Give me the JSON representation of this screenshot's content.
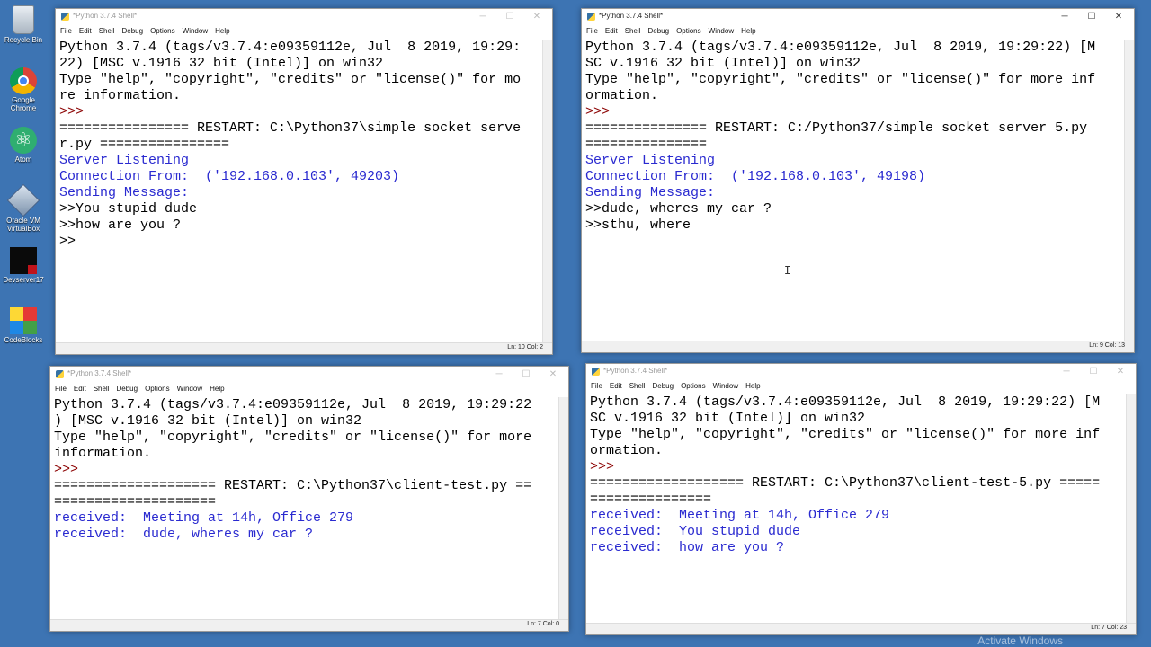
{
  "desktop": {
    "icons": [
      {
        "label": "Recycle Bin",
        "icon": "recycle-bin-icon"
      },
      {
        "label": "Google Chrome",
        "icon": "chrome-icon"
      },
      {
        "label": "Atom",
        "icon": "atom-icon"
      },
      {
        "label": "Oracle VM VirtualBox",
        "icon": "virtualbox-icon"
      },
      {
        "label": "Devserver17",
        "icon": "devserver-icon"
      },
      {
        "label": "CodeBlocks",
        "icon": "codeblocks-icon"
      }
    ],
    "watermark": "Activate Windows"
  },
  "menu_items": [
    "File",
    "Edit",
    "Shell",
    "Debug",
    "Options",
    "Window",
    "Help"
  ],
  "window_controls": {
    "minimize": "─",
    "maximize": "☐",
    "close": "✕"
  },
  "windows": [
    {
      "title": "*Python 3.7.4 Shell*",
      "status": "Ln: 10   Col: 2",
      "lines": [
        {
          "t": "Python 3.7.4 (tags/v3.7.4:e09359112e, Jul  8 2019, 19:29:",
          "c": "input"
        },
        {
          "t": "22) [MSC v.1916 32 bit (Intel)] on win32",
          "c": "input"
        },
        {
          "t": "Type \"help\", \"copyright\", \"credits\" or \"license()\" for mo",
          "c": "input"
        },
        {
          "t": "re information.",
          "c": "input"
        },
        {
          "t": ">>> ",
          "c": "prompt"
        },
        {
          "t": "================ RESTART: C:\\Python37\\simple socket serve",
          "c": "input"
        },
        {
          "t": "r.py ================",
          "c": "input"
        },
        {
          "t": "Server Listening",
          "c": "out"
        },
        {
          "t": "Connection From:  ('192.168.0.103', 49203)",
          "c": "out"
        },
        {
          "t": "Sending Message:",
          "c": "out"
        },
        {
          "t": ">>You stupid dude",
          "c": "input"
        },
        {
          "t": ">>how are you ?",
          "c": "input"
        },
        {
          "t": ">> ",
          "c": "input"
        }
      ]
    },
    {
      "title": "*Python 3.7.4 Shell*",
      "status": "Ln: 9   Col: 13",
      "lines": [
        {
          "t": "Python 3.7.4 (tags/v3.7.4:e09359112e, Jul  8 2019, 19:29:22) [M",
          "c": "input"
        },
        {
          "t": "SC v.1916 32 bit (Intel)] on win32",
          "c": "input"
        },
        {
          "t": "Type \"help\", \"copyright\", \"credits\" or \"license()\" for more inf",
          "c": "input"
        },
        {
          "t": "ormation.",
          "c": "input"
        },
        {
          "t": ">>> ",
          "c": "prompt"
        },
        {
          "t": "=============== RESTART: C:/Python37/simple socket server 5.py",
          "c": "input"
        },
        {
          "t": "===============",
          "c": "input"
        },
        {
          "t": "Server Listening",
          "c": "out"
        },
        {
          "t": "Connection From:  ('192.168.0.103', 49198)",
          "c": "out"
        },
        {
          "t": "Sending Message:",
          "c": "out"
        },
        {
          "t": ">>dude, wheres my car ?",
          "c": "input"
        },
        {
          "t": ">>sthu, where",
          "c": "input"
        }
      ]
    },
    {
      "title": "*Python 3.7.4 Shell*",
      "status": "Ln: 7   Col: 0",
      "lines": [
        {
          "t": "Python 3.7.4 (tags/v3.7.4:e09359112e, Jul  8 2019, 19:29:22",
          "c": "input"
        },
        {
          "t": ") [MSC v.1916 32 bit (Intel)] on win32",
          "c": "input"
        },
        {
          "t": "Type \"help\", \"copyright\", \"credits\" or \"license()\" for more",
          "c": "input"
        },
        {
          "t": "information.",
          "c": "input"
        },
        {
          "t": ">>> ",
          "c": "prompt"
        },
        {
          "t": "==================== RESTART: C:\\Python37\\client-test.py ==",
          "c": "input"
        },
        {
          "t": "====================",
          "c": "input"
        },
        {
          "t": "received:  Meeting at 14h, Office 279",
          "c": "out"
        },
        {
          "t": "received:  dude, wheres my car ?",
          "c": "out"
        }
      ]
    },
    {
      "title": "*Python 3.7.4 Shell*",
      "status": "Ln: 7   Col: 23",
      "lines": [
        {
          "t": "Python 3.7.4 (tags/v3.7.4:e09359112e, Jul  8 2019, 19:29:22) [M",
          "c": "input"
        },
        {
          "t": "SC v.1916 32 bit (Intel)] on win32",
          "c": "input"
        },
        {
          "t": "Type \"help\", \"copyright\", \"credits\" or \"license()\" for more inf",
          "c": "input"
        },
        {
          "t": "ormation.",
          "c": "input"
        },
        {
          "t": ">>> ",
          "c": "prompt"
        },
        {
          "t": "=================== RESTART: C:\\Python37\\client-test-5.py =====",
          "c": "input"
        },
        {
          "t": "===============",
          "c": "input"
        },
        {
          "t": "received:  Meeting at 14h, Office 279",
          "c": "out"
        },
        {
          "t": "received:  You stupid dude",
          "c": "out"
        },
        {
          "t": "received:  how are you ?",
          "c": "out"
        }
      ]
    }
  ]
}
